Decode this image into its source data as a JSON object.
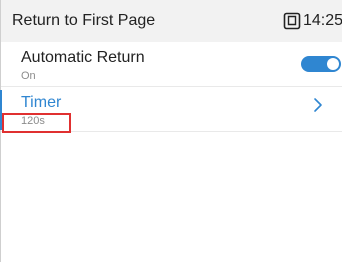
{
  "header": {
    "title": "Return to First Page",
    "time": "14:25",
    "status_icon": "message-icon"
  },
  "settings": [
    {
      "label": "Automatic Return",
      "value": "On",
      "control": "toggle",
      "enabled": true
    },
    {
      "label": "Timer",
      "value": "120s",
      "control": "chevron"
    }
  ],
  "colors": {
    "accent": "#2f86d1",
    "highlight": "#e03030",
    "header_bg": "#f2f2f2"
  }
}
